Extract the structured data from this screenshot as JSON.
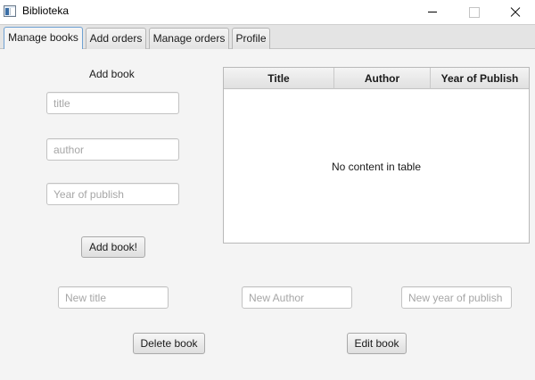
{
  "window": {
    "title": "Biblioteka",
    "icon": "app-icon"
  },
  "tabs": [
    {
      "label": "Manage books",
      "active": true
    },
    {
      "label": "Add orders",
      "active": false
    },
    {
      "label": "Manage orders",
      "active": false
    },
    {
      "label": "Profile",
      "active": false
    }
  ],
  "add_book": {
    "heading": "Add book",
    "title_placeholder": "title",
    "author_placeholder": "author",
    "year_placeholder": "Year of publish",
    "submit_label": "Add book!"
  },
  "table": {
    "columns": [
      "Title",
      "Author",
      "Year of Publish"
    ],
    "rows": [],
    "empty_text": "No content in table"
  },
  "edit": {
    "new_title_placeholder": "New title",
    "new_author_placeholder": "New Author",
    "new_year_placeholder": "New year of publish",
    "delete_label": "Delete book",
    "edit_label": "Edit book"
  },
  "colors": {
    "active_tab_border": "#6ea1d3",
    "content_background": "#f4f4f4"
  }
}
